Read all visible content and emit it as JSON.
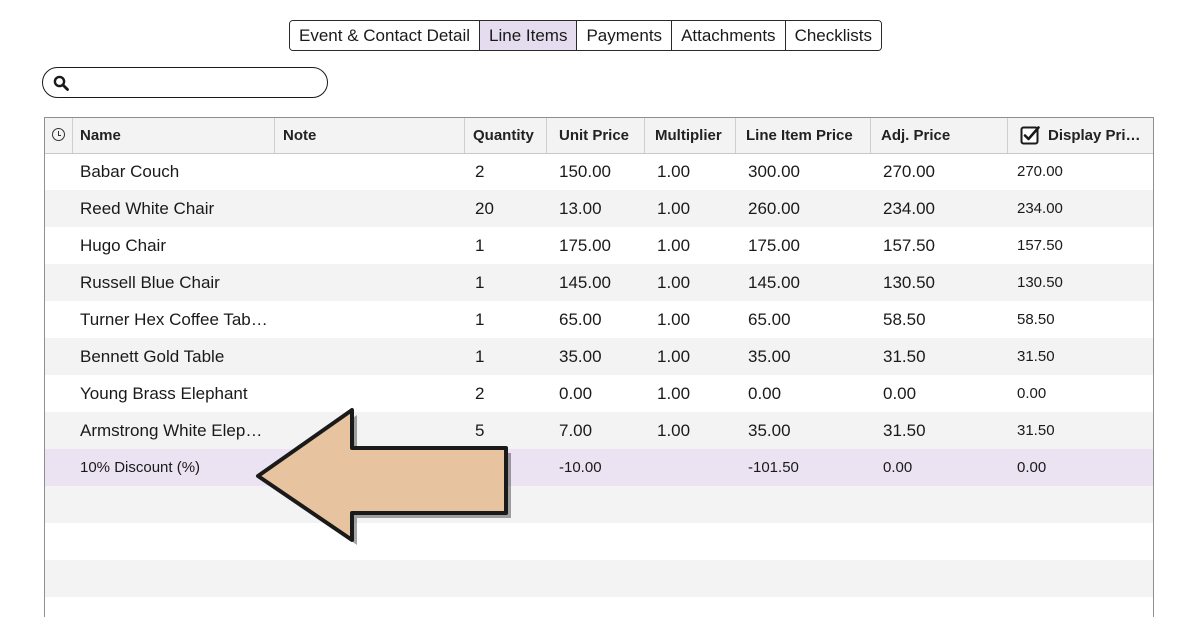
{
  "tabs": [
    {
      "label": "Event & Contact Detail",
      "active": false
    },
    {
      "label": "Line Items",
      "active": true
    },
    {
      "label": "Payments",
      "active": false
    },
    {
      "label": "Attachments",
      "active": false
    },
    {
      "label": "Checklists",
      "active": false
    }
  ],
  "search": {
    "value": "",
    "placeholder": ""
  },
  "columns": {
    "name": "Name",
    "note": "Note",
    "quantity": "Quantity",
    "unit_price": "Unit Price",
    "multiplier": "Multiplier",
    "line_item_price": "Line Item Price",
    "adj_price": "Adj. Price",
    "display_price": "Display Pri…"
  },
  "rows": [
    {
      "name": "Babar Couch",
      "note": "",
      "quantity": "2",
      "unit_price": "150.00",
      "multiplier": "1.00",
      "line_item_price": "300.00",
      "adj_price": "270.00",
      "display_price": "270.00"
    },
    {
      "name": "Reed White Chair",
      "note": "",
      "quantity": "20",
      "unit_price": "13.00",
      "multiplier": "1.00",
      "line_item_price": "260.00",
      "adj_price": "234.00",
      "display_price": "234.00"
    },
    {
      "name": "Hugo Chair",
      "note": "",
      "quantity": "1",
      "unit_price": "175.00",
      "multiplier": "1.00",
      "line_item_price": "175.00",
      "adj_price": "157.50",
      "display_price": "157.50"
    },
    {
      "name": "Russell Blue Chair",
      "note": "",
      "quantity": "1",
      "unit_price": "145.00",
      "multiplier": "1.00",
      "line_item_price": "145.00",
      "adj_price": "130.50",
      "display_price": "130.50"
    },
    {
      "name": "Turner Hex Coffee Tab…",
      "note": "",
      "quantity": "1",
      "unit_price": "65.00",
      "multiplier": "1.00",
      "line_item_price": "65.00",
      "adj_price": "58.50",
      "display_price": "58.50"
    },
    {
      "name": "Bennett Gold Table",
      "note": "",
      "quantity": "1",
      "unit_price": "35.00",
      "multiplier": "1.00",
      "line_item_price": "35.00",
      "adj_price": "31.50",
      "display_price": "31.50"
    },
    {
      "name": "Young Brass Elephant",
      "note": "",
      "quantity": "2",
      "unit_price": "0.00",
      "multiplier": "1.00",
      "line_item_price": "0.00",
      "adj_price": "0.00",
      "display_price": "0.00"
    },
    {
      "name": "Armstrong White Elep…",
      "note": "",
      "quantity": "5",
      "unit_price": "7.00",
      "multiplier": "1.00",
      "line_item_price": "35.00",
      "adj_price": "31.50",
      "display_price": "31.50"
    }
  ],
  "discount_row": {
    "name": "10% Discount (%)",
    "unit_price": "-10.00",
    "line_item_price": "-101.50",
    "adj_price": "0.00",
    "display_price": "0.00"
  },
  "colors": {
    "accent_tab": "#e6dcef",
    "discount_row": "#ece3f2",
    "arrow_fill": "#e8c39f"
  },
  "icons": {
    "search": "search-icon",
    "history": "clock-icon",
    "display_toggle": "checkbox-icon",
    "callout": "arrow-left-icon"
  }
}
